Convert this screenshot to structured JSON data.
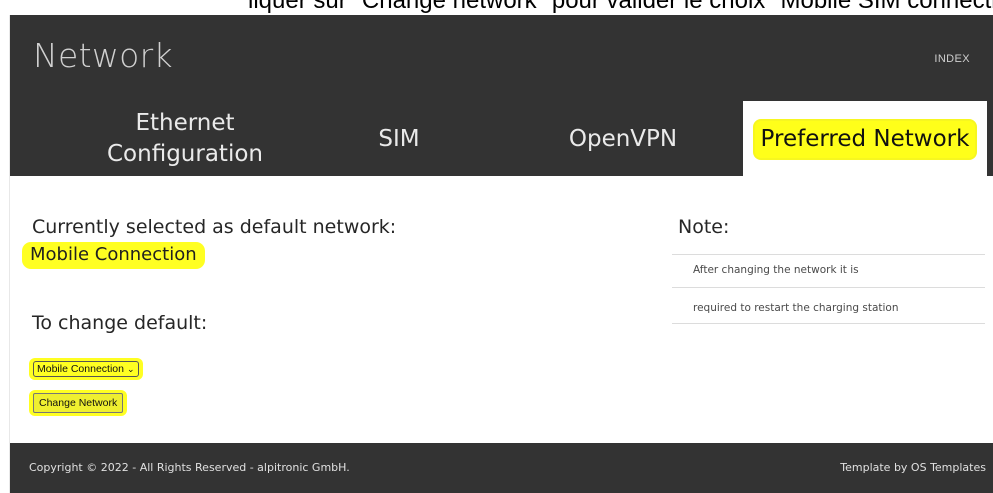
{
  "caption": "liquer sur \"Change network\" pour valider le choix \"Mobile SIM connection",
  "header": {
    "title": "Network",
    "index_link": "INDEX"
  },
  "tabs": [
    {
      "label_line1": "Ethernet",
      "label_line2": "Configuration",
      "active": false
    },
    {
      "label": "SIM",
      "active": false
    },
    {
      "label": "OpenVPN",
      "active": false
    },
    {
      "label": "Preferred Network",
      "active": true
    }
  ],
  "main": {
    "current_label": "Currently selected as default network:",
    "current_value": "Mobile Connection",
    "change_label": "To change default:",
    "select_value": "Mobile Connection",
    "change_button": "Change Network"
  },
  "note": {
    "title": "Note:",
    "lines": [
      "After changing the network it is",
      "required to restart the charging station"
    ]
  },
  "footer": {
    "copyright": "Copyright © 2022 - All Rights Reserved - alpitronic GmbH.",
    "template_credit": "Template by OS Templates"
  },
  "colors": {
    "header_bg": "#333333",
    "highlight": "#ffff22",
    "active_tab_bg": "#ffffff"
  }
}
